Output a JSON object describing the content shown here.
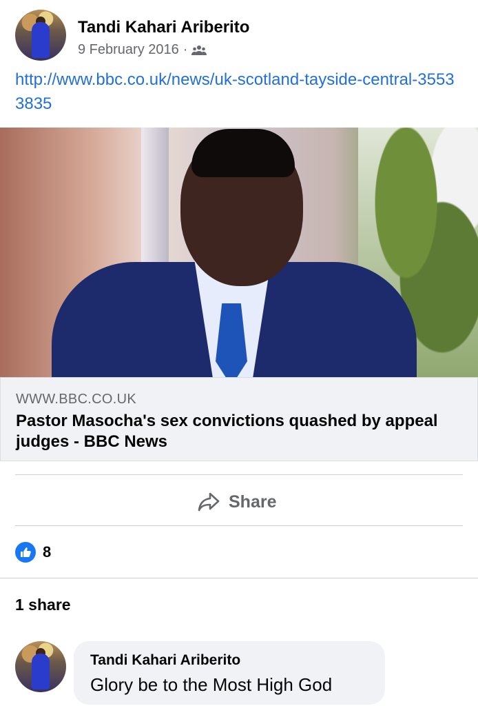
{
  "post": {
    "author": "Tandi Kahari Ariberito",
    "date": "9 February 2016",
    "separator": "·",
    "audience_icon": "friends-icon",
    "link_text": "http://www.bbc.co.uk/news/uk-scotland-tayside-central-35533835"
  },
  "link_preview": {
    "domain": "WWW.BBC.CO.UK",
    "headline": "Pastor Masocha's sex convictions quashed by appeal judges - BBC News"
  },
  "actions": {
    "share_label": "Share"
  },
  "stats": {
    "like_count": "8",
    "shares_text": "1 share"
  },
  "comment": {
    "author": "Tandi Kahari Ariberito",
    "text": "Glory be to the Most High God"
  },
  "colors": {
    "link": "#216fdb",
    "like_blue": "#1877f2",
    "muted": "#65676b"
  }
}
